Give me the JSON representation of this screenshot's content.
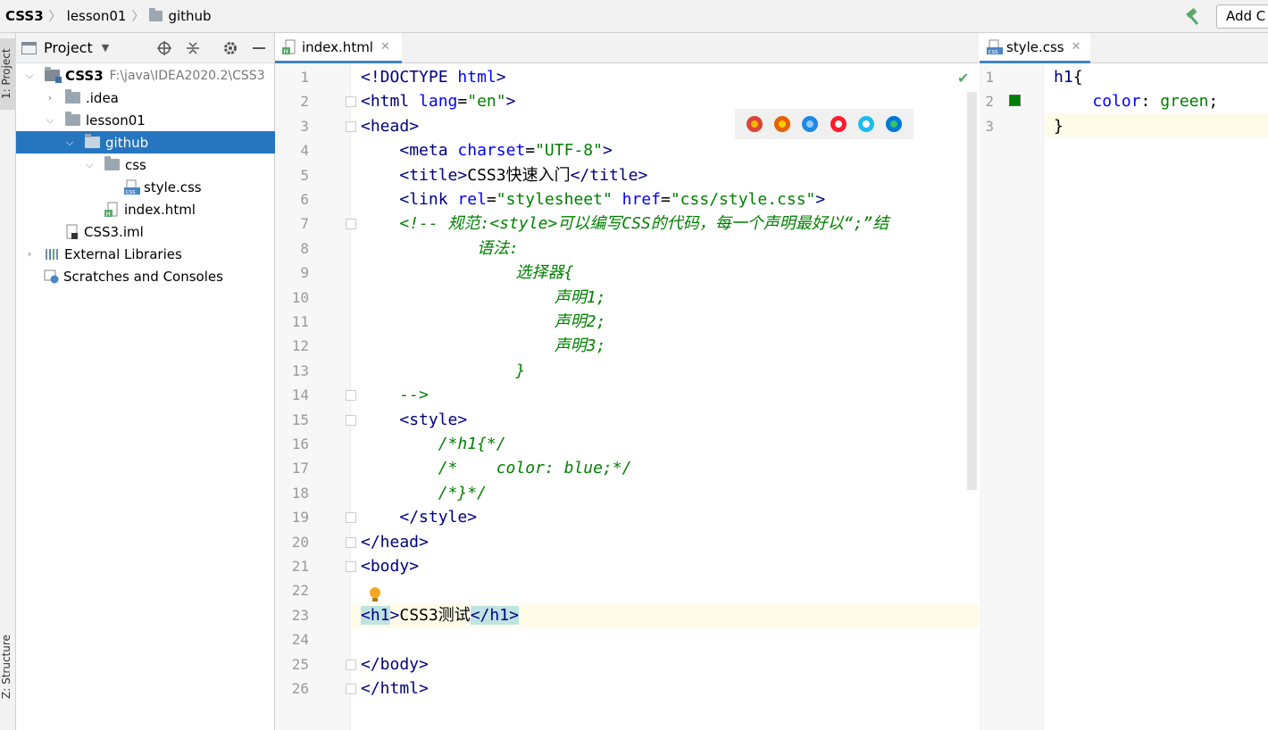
{
  "navbar": {
    "breadcrumbs": [
      "CSS3",
      "lesson01",
      "github"
    ],
    "add_config_label": "Add C"
  },
  "toolstrip": {
    "project_label": "1: Project",
    "structure_label": "Z: Structure"
  },
  "project_panel": {
    "title": "Project",
    "tree": [
      {
        "label": "CSS3",
        "note": "F:\\java\\IDEA2020.2\\CSS3",
        "type": "project",
        "depth": 0,
        "expanded": true
      },
      {
        "label": ".idea",
        "type": "folder",
        "depth": 1,
        "expanded": false
      },
      {
        "label": "lesson01",
        "type": "folder",
        "depth": 1,
        "expanded": true
      },
      {
        "label": "github",
        "type": "folder",
        "depth": 2,
        "expanded": true,
        "selected": true
      },
      {
        "label": "css",
        "type": "folder",
        "depth": 3,
        "expanded": true
      },
      {
        "label": "style.css",
        "type": "css-file",
        "depth": 4
      },
      {
        "label": "index.html",
        "type": "html-file",
        "depth": 3
      },
      {
        "label": "CSS3.iml",
        "type": "iml-file",
        "depth": 1
      },
      {
        "label": "External Libraries",
        "type": "libraries",
        "depth": 0,
        "expanded": false
      },
      {
        "label": "Scratches and Consoles",
        "type": "scratches",
        "depth": 0
      }
    ]
  },
  "editor_html": {
    "tab_label": "index.html",
    "current_line": 23,
    "lines": [
      "<!DOCTYPE html>",
      "<html lang=\"en\">",
      "<head>",
      "    <meta charset=\"UTF-8\">",
      "    <title>CSS3快速入门</title>",
      "    <link rel=\"stylesheet\" href=\"css/style.css\">",
      "    <!-- 规范:<style>可以编写CSS的代码，每一个声明最好以“;”结",
      "            语法:",
      "                选择器{",
      "                    声明1;",
      "                    声明2;",
      "                    声明3;",
      "                }",
      "    -->",
      "    <style>",
      "        /*h1{*/",
      "        /*    color: blue;*/",
      "        /*}*/",
      "    </style>",
      "</head>",
      "<body>",
      "",
      "<h1>CSS3测试</h1>",
      "",
      "</body>",
      "</html>"
    ]
  },
  "editor_css": {
    "tab_label": "style.css",
    "current_line": 3,
    "swatch_color": "#008000",
    "lines": [
      "h1{",
      "    color: green;",
      "}"
    ]
  },
  "browsers": [
    "chrome-icon",
    "firefox-icon",
    "safari-icon",
    "opera-icon",
    "ie-icon",
    "edge-icon"
  ]
}
